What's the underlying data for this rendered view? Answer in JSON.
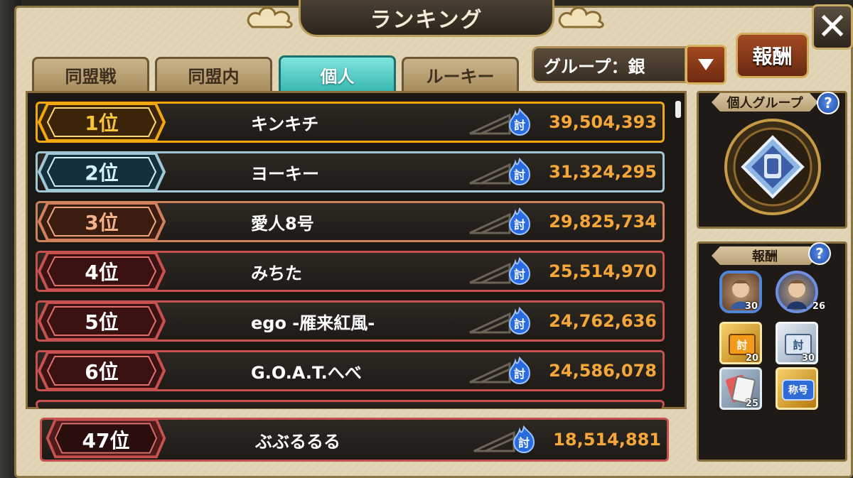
{
  "title": "ランキング",
  "close_label": "✕",
  "tabs": [
    {
      "label": "同盟戦",
      "active": false
    },
    {
      "label": "同盟内",
      "active": false
    },
    {
      "label": "個人",
      "active": true
    },
    {
      "label": "ルーキー",
      "active": false
    }
  ],
  "group_select": {
    "value": "グループ：銀"
  },
  "reward_button": "報酬",
  "metric_icon": "討",
  "rankings": [
    {
      "rank": "1位",
      "name": "キンキチ",
      "score": "39,504,393",
      "tier": "gold"
    },
    {
      "rank": "2位",
      "name": "ヨーキー",
      "score": "31,324,295",
      "tier": "silver"
    },
    {
      "rank": "3位",
      "name": "愛人8号",
      "score": "29,825,734",
      "tier": "bronze"
    },
    {
      "rank": "4位",
      "name": "みちた",
      "score": "25,514,970",
      "tier": "red"
    },
    {
      "rank": "5位",
      "name": "ego -雁来紅風-",
      "score": "24,762,636",
      "tier": "red"
    },
    {
      "rank": "6位",
      "name": "G.O.A.T.へべ",
      "score": "24,586,078",
      "tier": "red"
    }
  ],
  "self_rank": {
    "rank": "47位",
    "name": "ぶぶるるる",
    "score": "18,514,881"
  },
  "side": {
    "group_panel_title": "個人グループ",
    "reward_panel_title": "報酬",
    "help_label": "?",
    "rewards": [
      {
        "icon": "character-portrait-frame",
        "count": "30"
      },
      {
        "icon": "character-portrait-round",
        "count": "26"
      },
      {
        "icon": "gold-ticket-icon",
        "count": "20",
        "glyph": "討"
      },
      {
        "icon": "silver-ticket-icon",
        "count": "30",
        "glyph": "討"
      },
      {
        "icon": "card-pack-icon",
        "count": "25"
      },
      {
        "icon": "title-badge-icon",
        "count": "",
        "glyph": "称号"
      }
    ]
  },
  "colors": {
    "gold": "#f2a80d",
    "silver": "#9fc7d6",
    "bronze": "#d0805c",
    "red": "#c8514f",
    "score": "#f5a73a",
    "active_tab": "#35b7b0"
  }
}
